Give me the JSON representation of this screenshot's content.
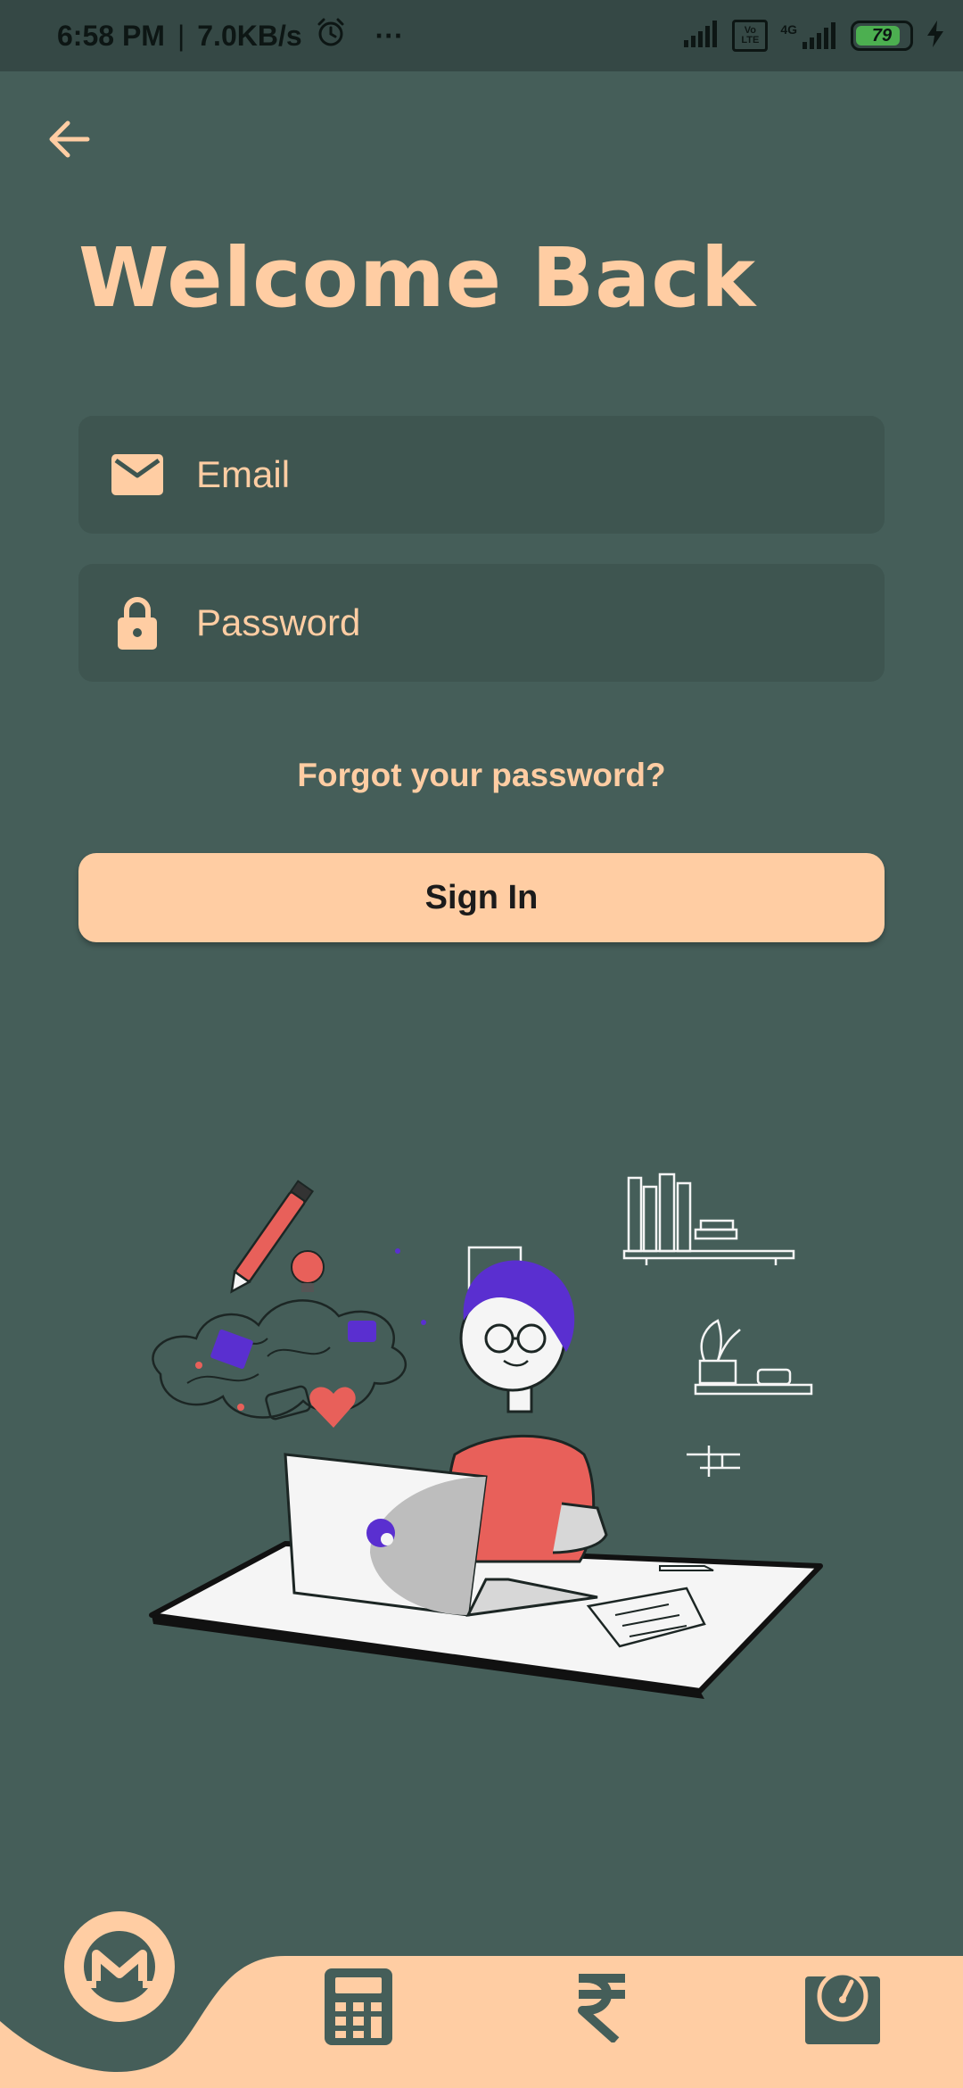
{
  "status_bar": {
    "time": "6:58 PM",
    "separator": "|",
    "speed": "7.0KB/s",
    "more": "···",
    "battery_level": "79",
    "volte_label": "Vo LTE",
    "network_label": "4G"
  },
  "header": {
    "title": "Welcome Back",
    "back_icon": "arrow-left-icon"
  },
  "form": {
    "email": {
      "placeholder": "Email",
      "value": "",
      "icon": "mail-icon"
    },
    "password": {
      "placeholder": "Password",
      "value": "",
      "icon": "lock-icon"
    },
    "forgot_label": "Forgot your password?",
    "signin_label": "Sign In"
  },
  "bottom_nav": {
    "items": [
      {
        "icon": "monero-icon",
        "active": true
      },
      {
        "icon": "calculator-icon"
      },
      {
        "icon": "rupee-icon"
      },
      {
        "icon": "gauge-icon"
      }
    ]
  },
  "colors": {
    "background": "#455E59",
    "accent": "#FFCDA3",
    "field": "#3E5550",
    "status_bar": "#354845"
  }
}
